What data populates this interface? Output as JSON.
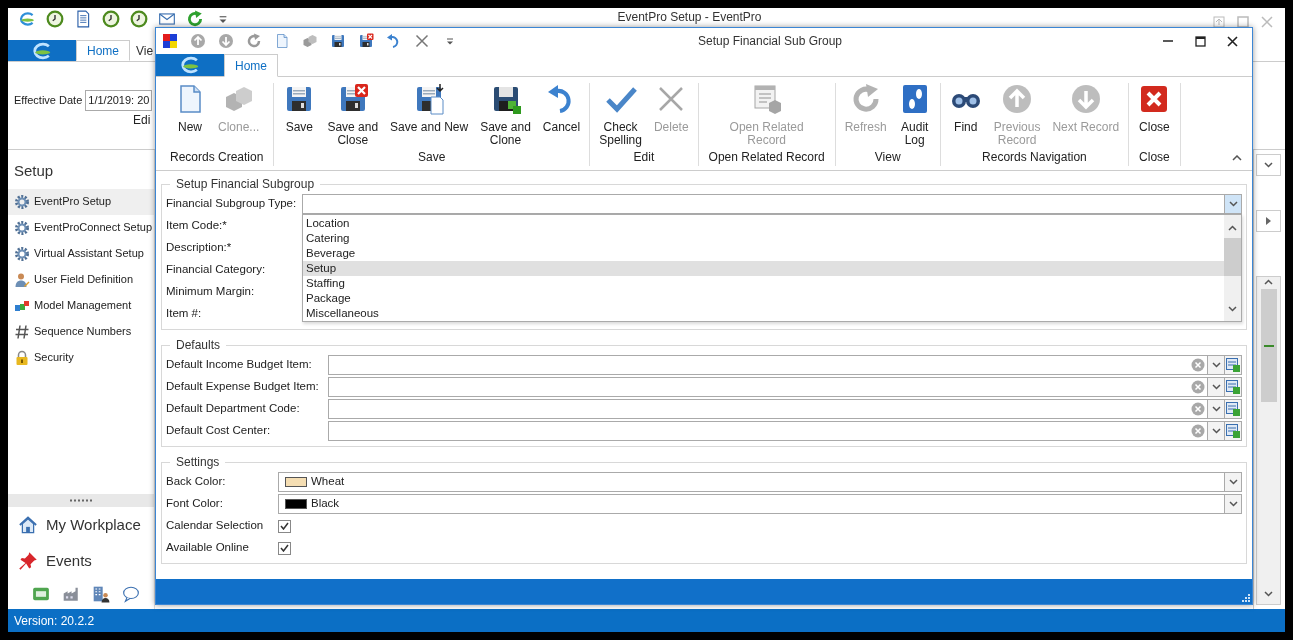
{
  "app": {
    "title": "EventPro Setup - EventPro",
    "tabs": [
      {
        "label": "Home",
        "selected": true
      },
      {
        "label": "Vie",
        "selected": false
      }
    ],
    "effective_date": {
      "label": "Effective Date",
      "value": "1/1/2019: 20"
    },
    "ribbon_group_label": "Edi",
    "sidebar": {
      "title": "Setup",
      "items": [
        {
          "label": "EventPro Setup",
          "selected": true
        },
        {
          "label": "EventProConnect Setup",
          "selected": false
        },
        {
          "label": "Virtual Assistant Setup",
          "selected": false
        },
        {
          "label": "User Field Definition",
          "selected": false
        },
        {
          "label": "Model Management",
          "selected": false
        },
        {
          "label": "Sequence Numbers",
          "selected": false
        },
        {
          "label": "Security",
          "selected": false
        }
      ]
    },
    "nav": [
      {
        "label": "My Workplace"
      },
      {
        "label": "Events"
      }
    ],
    "status_bar": "Version: 20.2.2"
  },
  "dialog": {
    "title": "Setup Financial Sub Group",
    "tabs": [
      {
        "label": "Home",
        "selected": true
      }
    ],
    "ribbon": [
      {
        "label": "Records Creation",
        "buttons": [
          {
            "label": "New",
            "disabled": false
          },
          {
            "label": "Clone...",
            "disabled": true
          }
        ]
      },
      {
        "label": "Save",
        "buttons": [
          {
            "label": "Save",
            "disabled": false
          },
          {
            "label": "Save and\nClose",
            "disabled": false
          },
          {
            "label": "Save and New",
            "disabled": false
          },
          {
            "label": "Save and\nClone",
            "disabled": false
          },
          {
            "label": "Cancel",
            "disabled": false
          }
        ]
      },
      {
        "label": "Edit",
        "buttons": [
          {
            "label": "Check\nSpelling",
            "disabled": false
          },
          {
            "label": "Delete",
            "disabled": true
          }
        ]
      },
      {
        "label": "Open Related Record",
        "buttons": [
          {
            "label": "Open Related\nRecord",
            "disabled": true
          }
        ]
      },
      {
        "label": "View",
        "buttons": [
          {
            "label": "Refresh",
            "disabled": true
          },
          {
            "label": "Audit\nLog",
            "disabled": false
          }
        ]
      },
      {
        "label": "Records Navigation",
        "buttons": [
          {
            "label": "Find",
            "disabled": false
          },
          {
            "label": "Previous\nRecord",
            "disabled": true
          },
          {
            "label": "Next Record",
            "disabled": true
          }
        ]
      },
      {
        "label": "Close",
        "buttons": [
          {
            "label": "Close",
            "disabled": false
          }
        ]
      }
    ],
    "sections": [
      {
        "title": "Setup Financial Subgroup",
        "fields": [
          {
            "label": "Financial Subgroup Type:",
            "kind": "combo",
            "expanded": true,
            "options": [
              {
                "label": "Location",
                "selected": false
              },
              {
                "label": "Catering",
                "selected": false
              },
              {
                "label": "Beverage",
                "selected": false
              },
              {
                "label": "Setup",
                "selected": true
              },
              {
                "label": "Staffing",
                "selected": false
              },
              {
                "label": "Package",
                "selected": false
              },
              {
                "label": "Miscellaneous",
                "selected": false
              }
            ]
          },
          {
            "label": "Item Code:*",
            "kind": "covered"
          },
          {
            "label": "Description:*",
            "kind": "covered"
          },
          {
            "label": "Financial Category:",
            "kind": "covered"
          },
          {
            "label": "Minimum Margin:",
            "kind": "covered"
          },
          {
            "label": "Item #:",
            "kind": "covered"
          }
        ]
      },
      {
        "title": "Defaults",
        "fields": [
          {
            "label": "Default Income Budget Item:",
            "kind": "lookup"
          },
          {
            "label": "Default Expense Budget Item:",
            "kind": "lookup"
          },
          {
            "label": "Default Department Code:",
            "kind": "lookup"
          },
          {
            "label": "Default Cost Center:",
            "kind": "lookup"
          }
        ]
      },
      {
        "title": "Settings",
        "fields": [
          {
            "label": "Back Color:",
            "kind": "color",
            "value": "Wheat",
            "color": "#f5deb3"
          },
          {
            "label": "Font Color:",
            "kind": "color",
            "value": "Black",
            "color": "#000000"
          },
          {
            "label": "Calendar Selection",
            "kind": "check",
            "checked": true
          },
          {
            "label": "Available Online",
            "kind": "check",
            "checked": true
          }
        ]
      }
    ]
  }
}
